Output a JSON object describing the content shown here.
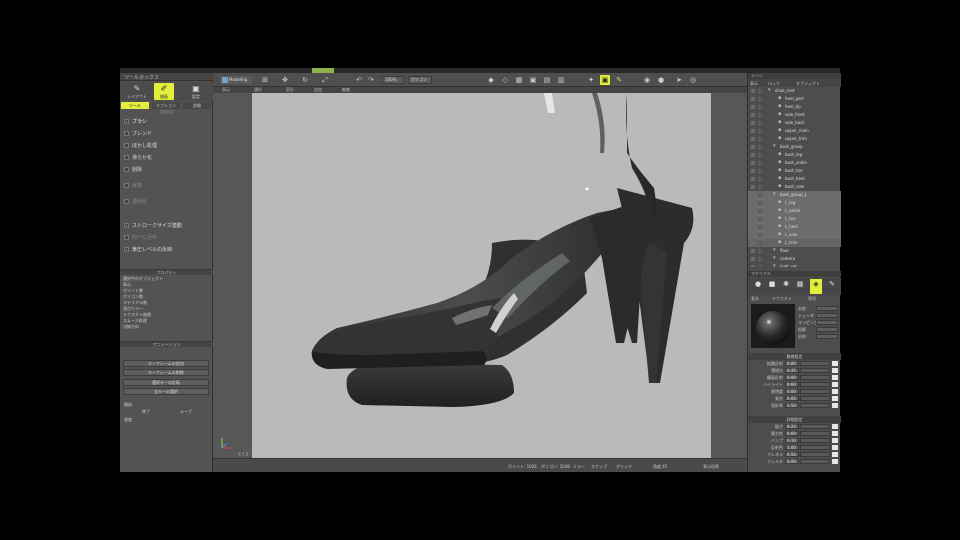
{
  "left_panel": {
    "top_label": "ツールボックス",
    "tools": [
      {
        "label": "レイアウト",
        "icon": "✎"
      },
      {
        "label": "描画",
        "icon": "✐"
      },
      {
        "label": "設定",
        "icon": "▣"
      }
    ],
    "tabs": [
      "ツール",
      "オプション",
      "詳細"
    ],
    "options": [
      {
        "label": "ブラシ",
        "checked": true
      },
      {
        "label": "ブレンド",
        "checked": false
      },
      {
        "label": "ぼかし処理",
        "checked": false
      },
      {
        "label": "滑らか化",
        "checked": false
      },
      {
        "label": "削除",
        "checked": false
      },
      {
        "label": "反転",
        "checked": false
      },
      {
        "label": "透明化",
        "checked": false
      },
      {
        "label": "ストロークサイズ連動",
        "checked": true
      },
      {
        "label": "均一に分布",
        "checked": false
      },
      {
        "label": "筆圧レベルの反映",
        "checked": true
      }
    ],
    "info_title": "プロパティ",
    "info_lines": [
      "選択中のオブジェクト",
      "表示",
      "ポイント数",
      "ポリゴン数",
      "マテリアル数",
      "頂点カラー",
      "テクスチャ座標",
      "スムーズ処理",
      "法線方向"
    ],
    "section2_title": "アニメーション",
    "buttons": [
      "キーフレームの追加",
      "キーフレームの削除",
      "選択キーの反転",
      "全キーの選択"
    ],
    "footer_labels": [
      "開始",
      "終了",
      "ループ",
      "速度"
    ]
  },
  "toolbar": {
    "tab_label": "Modeling",
    "zoom_field": "100%",
    "mode_field": "ポリゴン"
  },
  "doc_tabs": [
    "表示",
    "選択",
    "変形",
    "追加",
    "編集"
  ],
  "status": {
    "items": [
      "ポイント: 1024",
      "ポリゴン: 2048",
      "ミラー",
      "スナップ",
      "グリッド",
      "角度 45",
      "表示倍率"
    ],
    "axis": "X Y Z"
  },
  "right_panel": {
    "header": "シーン",
    "columns": [
      "表示",
      "ロック",
      "オブジェクト"
    ],
    "layers": [
      {
        "name": "shoe_root",
        "depth": 0,
        "state": ""
      },
      {
        "name": "heel_part",
        "depth": 2,
        "state": ""
      },
      {
        "name": "heel_tip",
        "depth": 2,
        "state": ""
      },
      {
        "name": "sole_front",
        "depth": 2,
        "state": ""
      },
      {
        "name": "sole_back",
        "depth": 2,
        "state": ""
      },
      {
        "name": "upper_main",
        "depth": 2,
        "state": ""
      },
      {
        "name": "upper_trim",
        "depth": 2,
        "state": ""
      },
      {
        "name": "boot_group",
        "depth": 1,
        "state": ""
      },
      {
        "name": "boot_leg",
        "depth": 2,
        "state": ""
      },
      {
        "name": "boot_ankle",
        "depth": 2,
        "state": ""
      },
      {
        "name": "boot_toe",
        "depth": 2,
        "state": ""
      },
      {
        "name": "boot_heel",
        "depth": 2,
        "state": ""
      },
      {
        "name": "boot_sole",
        "depth": 2,
        "state": ""
      },
      {
        "name": "boot_group_L",
        "depth": 1,
        "state": "sel"
      },
      {
        "name": "L_leg",
        "depth": 2,
        "state": "sel"
      },
      {
        "name": "L_ankle",
        "depth": 2,
        "state": "sel"
      },
      {
        "name": "L_toe",
        "depth": 2,
        "state": "sel"
      },
      {
        "name": "L_heel",
        "depth": 2,
        "state": "sel"
      },
      {
        "name": "L_sole",
        "depth": 2,
        "state": "sel"
      },
      {
        "name": "L_trim",
        "depth": 2,
        "state": "sel2"
      },
      {
        "name": "floor",
        "depth": 1,
        "state": ""
      },
      {
        "name": "camera",
        "depth": 1,
        "state": ""
      },
      {
        "name": "light_set",
        "depth": 1,
        "state": ""
      }
    ],
    "section_material": "マテリアル",
    "material_tabs": [
      "基本",
      "テクスチャ",
      "環境"
    ],
    "material_props": [
      "名前",
      "シェーダ",
      "マッピング",
      "投影",
      "反射"
    ],
    "group1_title": "質感設定",
    "group1": [
      {
        "label": "拡散反射",
        "value": "0.80"
      },
      {
        "label": "環境光",
        "value": "0.35"
      },
      {
        "label": "鏡面反射",
        "value": "0.90"
      },
      {
        "label": "ハイライト",
        "value": "0.60"
      },
      {
        "label": "透明度",
        "value": "0.00"
      },
      {
        "label": "発光",
        "value": "0.00"
      },
      {
        "label": "屈折率",
        "value": "1.50"
      }
    ],
    "group2_title": "詳細設定",
    "group2": [
      {
        "label": "粗さ",
        "value": "0.20"
      },
      {
        "label": "異方性",
        "value": "0.00"
      },
      {
        "label": "バンプ",
        "value": "0.10"
      },
      {
        "label": "反射色",
        "value": "1.00"
      },
      {
        "label": "フレネル",
        "value": "0.50"
      },
      {
        "label": "フィルタ",
        "value": "0.00"
      }
    ]
  },
  "colors": {
    "accent": "#e3ee3a",
    "panel": "#535353",
    "canvas": "#b9bbb9",
    "boot": "#3a3c3b"
  }
}
